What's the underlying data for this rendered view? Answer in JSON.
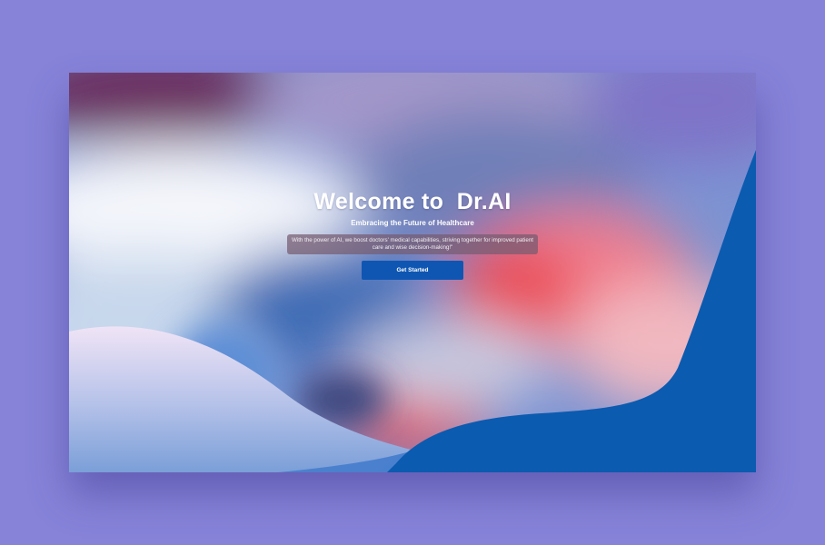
{
  "hero": {
    "title": "Welcome to  Dr.AI",
    "subtitle": "Embracing the Future of Healthcare",
    "description": "With the power of AI, we boost doctors' medical capabilities, striving together for improved patient care and wise decision-making!\""
  },
  "cta": {
    "label": "Get Started"
  },
  "colors": {
    "page_background": "#8683d9",
    "button": "#0f56b3",
    "wave_blue": "#0b5bb0"
  }
}
